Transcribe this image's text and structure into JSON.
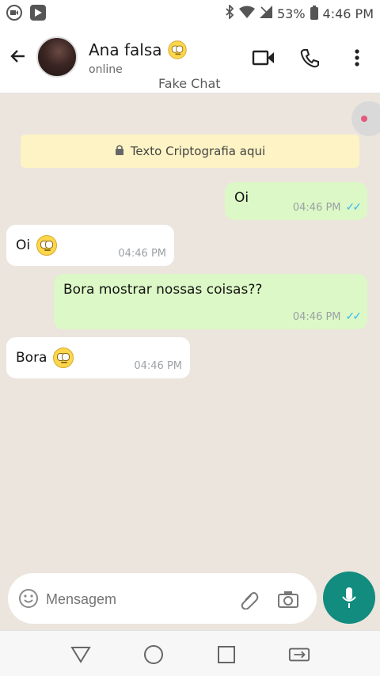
{
  "status_bar": {
    "battery_percent": "53%",
    "time": "4:46 PM",
    "icons": [
      "screen-record-icon",
      "play-store-icon",
      "bluetooth-icon",
      "wifi-icon",
      "signal-icon",
      "battery-icon"
    ]
  },
  "header": {
    "contact_name": "Ana falsa",
    "contact_status": "online",
    "subtitle": "Fake Chat",
    "icons": [
      "back-arrow-icon",
      "video-call-icon",
      "phone-icon",
      "more-vert-icon"
    ]
  },
  "chat": {
    "encryption_notice": "Texto Criptografia aqui",
    "messages": [
      {
        "direction": "out",
        "text": "Oi",
        "time": "04:46 PM",
        "read": true
      },
      {
        "direction": "in",
        "text": "Oi",
        "time": "04:46 PM",
        "emoji": "face-with-rolling-eyes"
      },
      {
        "direction": "out",
        "text": "Bora mostrar nossas coisas??",
        "time": "04:46 PM",
        "read": true
      },
      {
        "direction": "in",
        "text": "Bora",
        "time": "04:46 PM",
        "emoji": "face-with-rolling-eyes"
      }
    ]
  },
  "composer": {
    "placeholder": "Mensagem"
  },
  "colors": {
    "outgoing_bubble": "#dcf8c6",
    "incoming_bubble": "#ffffff",
    "chat_background": "#ece5dd",
    "accent": "#128c7e",
    "read_ticks": "#34b7f1",
    "encryption_bg": "#fdf3c4"
  }
}
